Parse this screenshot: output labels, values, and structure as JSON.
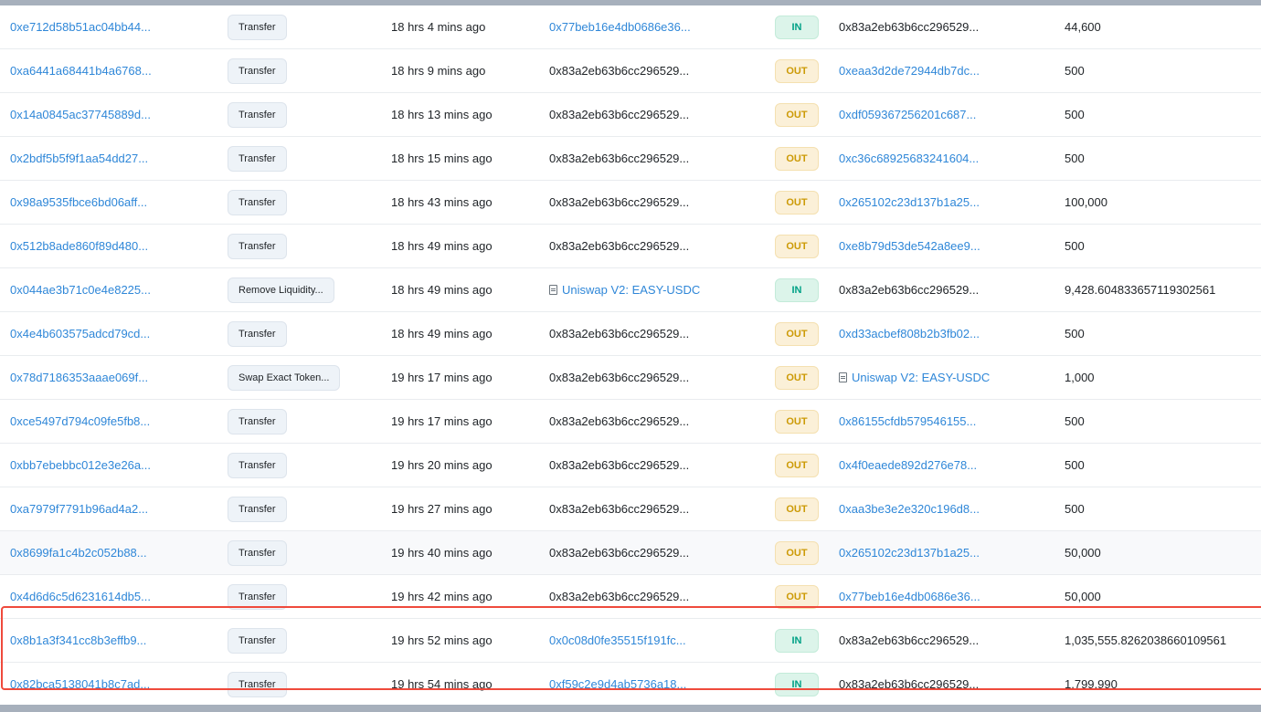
{
  "colors": {
    "link": "#2f87d8",
    "in_badge": "#00a186",
    "out_badge": "#cc9a06",
    "highlight": "#ef4a3c"
  },
  "rows": [
    {
      "hash": "0xe712d58b51ac04bb44...",
      "method": "Transfer",
      "age": "18 hrs 4 mins ago",
      "from": "0x77beb16e4db0686e36...",
      "from_link": true,
      "from_contract": false,
      "dir": "IN",
      "to": "0x83a2eb63b6cc296529...",
      "to_link": false,
      "to_contract": false,
      "value": "44,600"
    },
    {
      "hash": "0xa6441a68441b4a6768...",
      "method": "Transfer",
      "age": "18 hrs 9 mins ago",
      "from": "0x83a2eb63b6cc296529...",
      "from_link": false,
      "from_contract": false,
      "dir": "OUT",
      "to": "0xeaa3d2de72944db7dc...",
      "to_link": true,
      "to_contract": false,
      "value": "500"
    },
    {
      "hash": "0x14a0845ac37745889d...",
      "method": "Transfer",
      "age": "18 hrs 13 mins ago",
      "from": "0x83a2eb63b6cc296529...",
      "from_link": false,
      "from_contract": false,
      "dir": "OUT",
      "to": "0xdf059367256201c687...",
      "to_link": true,
      "to_contract": false,
      "value": "500"
    },
    {
      "hash": "0x2bdf5b5f9f1aa54dd27...",
      "method": "Transfer",
      "age": "18 hrs 15 mins ago",
      "from": "0x83a2eb63b6cc296529...",
      "from_link": false,
      "from_contract": false,
      "dir": "OUT",
      "to": "0xc36c68925683241604...",
      "to_link": true,
      "to_contract": false,
      "value": "500"
    },
    {
      "hash": "0x98a9535fbce6bd06aff...",
      "method": "Transfer",
      "age": "18 hrs 43 mins ago",
      "from": "0x83a2eb63b6cc296529...",
      "from_link": false,
      "from_contract": false,
      "dir": "OUT",
      "to": "0x265102c23d137b1a25...",
      "to_link": true,
      "to_contract": false,
      "value": "100,000"
    },
    {
      "hash": "0x512b8ade860f89d480...",
      "method": "Transfer",
      "age": "18 hrs 49 mins ago",
      "from": "0x83a2eb63b6cc296529...",
      "from_link": false,
      "from_contract": false,
      "dir": "OUT",
      "to": "0xe8b79d53de542a8ee9...",
      "to_link": true,
      "to_contract": false,
      "value": "500"
    },
    {
      "hash": "0x044ae3b71c0e4e8225...",
      "method": "Remove Liquidity...",
      "age": "18 hrs 49 mins ago",
      "from": "Uniswap V2: EASY-USDC",
      "from_link": true,
      "from_contract": true,
      "dir": "IN",
      "to": "0x83a2eb63b6cc296529...",
      "to_link": false,
      "to_contract": false,
      "value": "9,428.604833657119302561"
    },
    {
      "hash": "0x4e4b603575adcd79cd...",
      "method": "Transfer",
      "age": "18 hrs 49 mins ago",
      "from": "0x83a2eb63b6cc296529...",
      "from_link": false,
      "from_contract": false,
      "dir": "OUT",
      "to": "0xd33acbef808b2b3fb02...",
      "to_link": true,
      "to_contract": false,
      "value": "500"
    },
    {
      "hash": "0x78d7186353aaae069f...",
      "method": "Swap Exact Token...",
      "age": "19 hrs 17 mins ago",
      "from": "0x83a2eb63b6cc296529...",
      "from_link": false,
      "from_contract": false,
      "dir": "OUT",
      "to": "Uniswap V2: EASY-USDC",
      "to_link": true,
      "to_contract": true,
      "value": "1,000"
    },
    {
      "hash": "0xce5497d794c09fe5fb8...",
      "method": "Transfer",
      "age": "19 hrs 17 mins ago",
      "from": "0x83a2eb63b6cc296529...",
      "from_link": false,
      "from_contract": false,
      "dir": "OUT",
      "to": "0x86155cfdb579546155...",
      "to_link": true,
      "to_contract": false,
      "value": "500"
    },
    {
      "hash": "0xbb7ebebbc012e3e26a...",
      "method": "Transfer",
      "age": "19 hrs 20 mins ago",
      "from": "0x83a2eb63b6cc296529...",
      "from_link": false,
      "from_contract": false,
      "dir": "OUT",
      "to": "0x4f0eaede892d276e78...",
      "to_link": true,
      "to_contract": false,
      "value": "500"
    },
    {
      "hash": "0xa7979f7791b96ad4a2...",
      "method": "Transfer",
      "age": "19 hrs 27 mins ago",
      "from": "0x83a2eb63b6cc296529...",
      "from_link": false,
      "from_contract": false,
      "dir": "OUT",
      "to": "0xaa3be3e2e320c196d8...",
      "to_link": true,
      "to_contract": false,
      "value": "500"
    },
    {
      "hash": "0x8699fa1c4b2c052b88...",
      "method": "Transfer",
      "age": "19 hrs 40 mins ago",
      "from": "0x83a2eb63b6cc296529...",
      "from_link": false,
      "from_contract": false,
      "dir": "OUT",
      "to": "0x265102c23d137b1a25...",
      "to_link": true,
      "to_contract": false,
      "value": "50,000",
      "hover": true
    },
    {
      "hash": "0x4d6d6c5d6231614db5...",
      "method": "Transfer",
      "age": "19 hrs 42 mins ago",
      "from": "0x83a2eb63b6cc296529...",
      "from_link": false,
      "from_contract": false,
      "dir": "OUT",
      "to": "0x77beb16e4db0686e36...",
      "to_link": true,
      "to_contract": false,
      "value": "50,000"
    },
    {
      "hash": "0x8b1a3f341cc8b3effb9...",
      "method": "Transfer",
      "age": "19 hrs 52 mins ago",
      "from": "0x0c08d0fe35515f191fc...",
      "from_link": true,
      "from_contract": false,
      "dir": "IN",
      "to": "0x83a2eb63b6cc296529...",
      "to_link": false,
      "to_contract": false,
      "value": "1,035,555.8262038660109561"
    },
    {
      "hash": "0x82bca5138041b8c7ad...",
      "method": "Transfer",
      "age": "19 hrs 54 mins ago",
      "from": "0xf59c2e9d4ab5736a18...",
      "from_link": true,
      "from_contract": false,
      "dir": "IN",
      "to": "0x83a2eb63b6cc296529...",
      "to_link": false,
      "to_contract": false,
      "value": "1,799,990"
    }
  ]
}
